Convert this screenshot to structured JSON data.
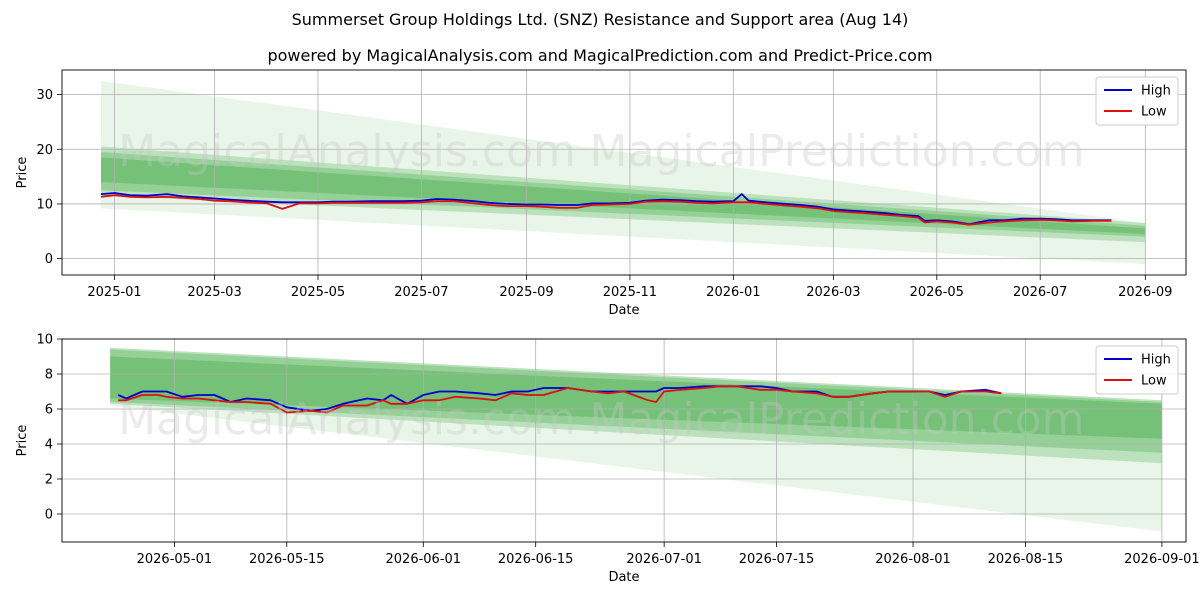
{
  "title": "Summerset Group Holdings Ltd. (SNZ) Resistance and Support area (Aug 14)",
  "subtitle": "powered by MagicalAnalysis.com and MagicalPrediction.com and Predict-Price.com",
  "watermarks": [
    "MagicalAnalysis.com",
    "MagicalPrediction.com"
  ],
  "colors": {
    "high": "#0000cc",
    "low": "#dd1111",
    "band": "#4caf50",
    "grid": "#b0b0b0"
  },
  "chart_data": [
    {
      "type": "line",
      "xlabel": "Date",
      "ylabel": "Price",
      "xlim": [
        "2024-12-01",
        "2026-09-25"
      ],
      "ylim": [
        -3,
        34.5
      ],
      "x_ticks": [
        "2025-01-01",
        "2025-03-01",
        "2025-05-01",
        "2025-07-01",
        "2025-09-01",
        "2025-11-01",
        "2026-01-01",
        "2026-03-01",
        "2026-05-01",
        "2026-07-01",
        "2026-09-01"
      ],
      "x_tick_labels": [
        "2025-01",
        "2025-03",
        "2025-05",
        "2025-07",
        "2025-09",
        "2025-11",
        "2026-01",
        "2026-03",
        "2026-05",
        "2026-07",
        "2026-09"
      ],
      "y_ticks": [
        0,
        10,
        20,
        30
      ],
      "grid": true,
      "legend": "top-right",
      "bands": [
        {
          "x_start": "2024-12-24",
          "x_end": "2026-09-01",
          "upper": [
            32.5,
            6.5
          ],
          "lower": [
            9.2,
            -1.0
          ],
          "opacity": 0.13
        },
        {
          "x_start": "2024-12-24",
          "x_end": "2026-09-01",
          "upper": [
            20.5,
            6.5
          ],
          "lower": [
            11.5,
            3.0
          ],
          "opacity": 0.28
        },
        {
          "x_start": "2024-12-24",
          "x_end": "2026-09-01",
          "upper": [
            19.5,
            6.0
          ],
          "lower": [
            12.5,
            4.0
          ],
          "opacity": 0.35
        },
        {
          "x_start": "2024-12-24",
          "x_end": "2026-09-01",
          "upper": [
            18.5,
            5.5
          ],
          "lower": [
            14.0,
            4.5
          ],
          "opacity": 0.45
        }
      ],
      "series": [
        {
          "name": "High",
          "x": [
            "2024-12-24",
            "2025-01-01",
            "2025-01-10",
            "2025-01-20",
            "2025-02-01",
            "2025-02-10",
            "2025-02-20",
            "2025-03-01",
            "2025-03-10",
            "2025-03-20",
            "2025-04-01",
            "2025-04-10",
            "2025-04-20",
            "2025-05-01",
            "2025-05-10",
            "2025-05-20",
            "2025-06-01",
            "2025-06-10",
            "2025-06-20",
            "2025-07-01",
            "2025-07-10",
            "2025-07-20",
            "2025-08-01",
            "2025-08-10",
            "2025-08-20",
            "2025-09-01",
            "2025-09-10",
            "2025-09-20",
            "2025-10-01",
            "2025-10-10",
            "2025-10-20",
            "2025-11-01",
            "2025-11-10",
            "2025-11-20",
            "2025-12-01",
            "2025-12-10",
            "2025-12-20",
            "2026-01-01",
            "2026-01-06",
            "2026-01-10",
            "2026-01-20",
            "2026-02-01",
            "2026-02-10",
            "2026-02-20",
            "2026-03-01",
            "2026-03-10",
            "2026-03-20",
            "2026-04-01",
            "2026-04-10",
            "2026-04-20",
            "2026-04-24",
            "2026-05-01",
            "2026-05-10",
            "2026-05-20",
            "2026-06-01",
            "2026-06-10",
            "2026-06-20",
            "2026-07-01",
            "2026-07-10",
            "2026-07-20",
            "2026-08-01",
            "2026-08-12"
          ],
          "values": [
            11.8,
            12.0,
            11.6,
            11.5,
            11.8,
            11.4,
            11.2,
            11.0,
            10.8,
            10.6,
            10.4,
            10.3,
            10.3,
            10.3,
            10.4,
            10.4,
            10.5,
            10.5,
            10.5,
            10.6,
            10.9,
            10.8,
            10.5,
            10.2,
            10.0,
            9.9,
            9.9,
            9.8,
            9.8,
            10.1,
            10.1,
            10.2,
            10.6,
            10.8,
            10.7,
            10.5,
            10.4,
            10.5,
            11.8,
            10.6,
            10.3,
            10.0,
            9.8,
            9.5,
            9.0,
            8.8,
            8.6,
            8.3,
            8.0,
            7.8,
            6.9,
            7.0,
            6.8,
            6.3,
            7.0,
            7.0,
            7.3,
            7.3,
            7.2,
            7.0,
            7.0,
            7.0
          ]
        },
        {
          "name": "Low",
          "x": [
            "2024-12-24",
            "2025-01-01",
            "2025-01-10",
            "2025-01-20",
            "2025-02-01",
            "2025-02-10",
            "2025-02-20",
            "2025-03-01",
            "2025-03-10",
            "2025-03-20",
            "2025-04-01",
            "2025-04-10",
            "2025-04-20",
            "2025-05-01",
            "2025-05-10",
            "2025-05-20",
            "2025-06-01",
            "2025-06-10",
            "2025-06-20",
            "2025-07-01",
            "2025-07-10",
            "2025-07-20",
            "2025-08-01",
            "2025-08-10",
            "2025-08-20",
            "2025-09-01",
            "2025-09-10",
            "2025-09-20",
            "2025-10-01",
            "2025-10-10",
            "2025-10-20",
            "2025-11-01",
            "2025-11-10",
            "2025-11-20",
            "2025-12-01",
            "2025-12-10",
            "2025-12-20",
            "2026-01-01",
            "2026-01-06",
            "2026-01-10",
            "2026-01-20",
            "2026-02-01",
            "2026-02-10",
            "2026-02-20",
            "2026-03-01",
            "2026-03-10",
            "2026-03-20",
            "2026-04-01",
            "2026-04-10",
            "2026-04-20",
            "2026-04-24",
            "2026-05-01",
            "2026-05-10",
            "2026-05-20",
            "2026-06-01",
            "2026-06-10",
            "2026-06-20",
            "2026-07-01",
            "2026-07-10",
            "2026-07-20",
            "2026-08-01",
            "2026-08-12"
          ],
          "values": [
            11.3,
            11.6,
            11.3,
            11.2,
            11.3,
            11.1,
            10.9,
            10.6,
            10.5,
            10.3,
            10.1,
            9.1,
            10.1,
            10.1,
            10.2,
            10.2,
            10.2,
            10.2,
            10.2,
            10.3,
            10.5,
            10.5,
            10.1,
            9.8,
            9.6,
            9.6,
            9.5,
            9.3,
            9.3,
            9.8,
            9.9,
            10.0,
            10.4,
            10.5,
            10.4,
            10.2,
            10.1,
            10.3,
            10.3,
            10.3,
            10.0,
            9.7,
            9.5,
            9.2,
            8.7,
            8.5,
            8.3,
            8.0,
            7.8,
            7.5,
            6.6,
            6.8,
            6.6,
            6.2,
            6.6,
            6.8,
            7.0,
            7.1,
            7.0,
            6.8,
            6.9,
            6.9
          ]
        }
      ]
    },
    {
      "type": "line",
      "xlabel": "Date",
      "ylabel": "Price",
      "xlim": [
        "2026-04-17",
        "2026-09-04"
      ],
      "ylim": [
        -1.6,
        10.0
      ],
      "x_ticks": [
        "2026-05-01",
        "2026-05-15",
        "2026-06-01",
        "2026-06-15",
        "2026-07-01",
        "2026-07-15",
        "2026-08-01",
        "2026-08-15",
        "2026-09-01"
      ],
      "x_tick_labels": [
        "2026-05-01",
        "2026-05-15",
        "2026-06-01",
        "2026-06-15",
        "2026-07-01",
        "2026-07-15",
        "2026-08-01",
        "2026-08-15",
        "2026-09-01"
      ],
      "y_ticks": [
        0,
        2,
        4,
        6,
        8,
        10
      ],
      "grid": true,
      "legend": "top-right",
      "bands": [
        {
          "x_start": "2026-04-23",
          "x_end": "2026-09-01",
          "upper": [
            9.5,
            6.5
          ],
          "lower": [
            6.2,
            -1.0
          ],
          "opacity": 0.13
        },
        {
          "x_start": "2026-04-23",
          "x_end": "2026-09-01",
          "upper": [
            9.5,
            6.5
          ],
          "lower": [
            6.3,
            2.9
          ],
          "opacity": 0.28
        },
        {
          "x_start": "2026-04-23",
          "x_end": "2026-09-01",
          "upper": [
            9.4,
            6.4
          ],
          "lower": [
            6.4,
            3.5
          ],
          "opacity": 0.35
        },
        {
          "x_start": "2026-04-23",
          "x_end": "2026-09-01",
          "upper": [
            9.0,
            6.3
          ],
          "lower": [
            6.6,
            4.3
          ],
          "opacity": 0.45
        }
      ],
      "series": [
        {
          "name": "High",
          "x": [
            "2026-04-24",
            "2026-04-25",
            "2026-04-27",
            "2026-04-29",
            "2026-04-30",
            "2026-05-02",
            "2026-05-04",
            "2026-05-06",
            "2026-05-08",
            "2026-05-10",
            "2026-05-13",
            "2026-05-15",
            "2026-05-18",
            "2026-05-20",
            "2026-05-22",
            "2026-05-25",
            "2026-05-27",
            "2026-05-28",
            "2026-05-30",
            "2026-06-01",
            "2026-06-03",
            "2026-06-05",
            "2026-06-08",
            "2026-06-10",
            "2026-06-12",
            "2026-06-14",
            "2026-06-16",
            "2026-06-19",
            "2026-06-22",
            "2026-06-24",
            "2026-06-26",
            "2026-06-29",
            "2026-06-30",
            "2026-07-01",
            "2026-07-03",
            "2026-07-06",
            "2026-07-08",
            "2026-07-10",
            "2026-07-13",
            "2026-07-15",
            "2026-07-17",
            "2026-07-20",
            "2026-07-22",
            "2026-07-24",
            "2026-07-27",
            "2026-07-29",
            "2026-07-31",
            "2026-08-03",
            "2026-08-05",
            "2026-08-07",
            "2026-08-10",
            "2026-08-12"
          ],
          "values": [
            6.8,
            6.6,
            7.0,
            7.0,
            7.0,
            6.7,
            6.8,
            6.8,
            6.4,
            6.6,
            6.5,
            6.1,
            5.9,
            6.0,
            6.3,
            6.6,
            6.5,
            6.8,
            6.3,
            6.8,
            7.0,
            7.0,
            6.9,
            6.8,
            7.0,
            7.0,
            7.2,
            7.2,
            7.0,
            7.0,
            7.0,
            7.0,
            7.0,
            7.2,
            7.2,
            7.3,
            7.3,
            7.3,
            7.3,
            7.2,
            7.0,
            7.0,
            6.7,
            6.7,
            6.9,
            7.0,
            7.0,
            7.0,
            6.8,
            7.0,
            7.1,
            6.9
          ]
        },
        {
          "name": "Low",
          "x": [
            "2026-04-24",
            "2026-04-25",
            "2026-04-27",
            "2026-04-29",
            "2026-04-30",
            "2026-05-02",
            "2026-05-04",
            "2026-05-06",
            "2026-05-08",
            "2026-05-10",
            "2026-05-13",
            "2026-05-15",
            "2026-05-18",
            "2026-05-20",
            "2026-05-22",
            "2026-05-25",
            "2026-05-27",
            "2026-05-28",
            "2026-05-30",
            "2026-06-01",
            "2026-06-03",
            "2026-06-05",
            "2026-06-08",
            "2026-06-10",
            "2026-06-12",
            "2026-06-14",
            "2026-06-16",
            "2026-06-19",
            "2026-06-22",
            "2026-06-24",
            "2026-06-26",
            "2026-06-29",
            "2026-06-30",
            "2026-07-01",
            "2026-07-03",
            "2026-07-06",
            "2026-07-08",
            "2026-07-10",
            "2026-07-13",
            "2026-07-15",
            "2026-07-17",
            "2026-07-20",
            "2026-07-22",
            "2026-07-24",
            "2026-07-27",
            "2026-07-29",
            "2026-07-31",
            "2026-08-03",
            "2026-08-05",
            "2026-08-07",
            "2026-08-10",
            "2026-08-12"
          ],
          "values": [
            6.5,
            6.5,
            6.8,
            6.8,
            6.7,
            6.6,
            6.6,
            6.5,
            6.4,
            6.4,
            6.3,
            5.8,
            5.9,
            5.8,
            6.2,
            6.2,
            6.5,
            6.3,
            6.3,
            6.5,
            6.5,
            6.7,
            6.6,
            6.5,
            6.9,
            6.8,
            6.8,
            7.2,
            7.0,
            6.9,
            7.0,
            6.5,
            6.4,
            7.0,
            7.1,
            7.2,
            7.3,
            7.3,
            7.1,
            7.1,
            7.0,
            6.9,
            6.7,
            6.7,
            6.9,
            7.0,
            7.0,
            7.0,
            6.7,
            7.0,
            7.0,
            6.9
          ]
        }
      ]
    }
  ]
}
